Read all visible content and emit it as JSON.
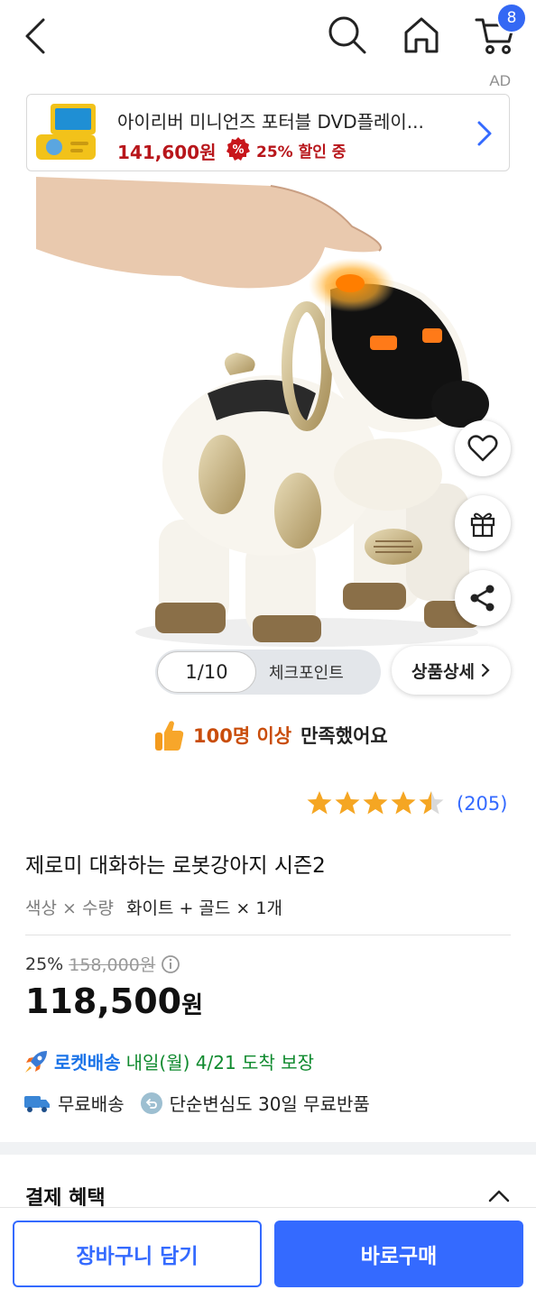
{
  "header": {
    "cart_count": "8",
    "ad_label": "AD"
  },
  "ad": {
    "title": "아이리버 미니언즈 포터블 DVD플레이...",
    "price": "141,600원",
    "discount_icon_symbol": "%",
    "discount": "25% 할인 중"
  },
  "gallery": {
    "counter": "1/10",
    "checkpoint": "체크포인트",
    "detail_label": "상품상세"
  },
  "satisfaction": {
    "highlight": "100명 이상",
    "rest": "만족했어요"
  },
  "rating": {
    "stars": 4.5,
    "count": "(205)"
  },
  "product": {
    "title": "제로미 대화하는 로봇강아지 시즌2",
    "option_label": "색상 × 수량",
    "option_value": "화이트 + 골드 × 1개",
    "discount_rate": "25%",
    "original_price": "158,000원",
    "price_number": "118,500",
    "price_unit": "원"
  },
  "delivery": {
    "rocket_label": "로켓배송",
    "arrival": "내일(월) 4/21 도착 보장",
    "free_shipping": "무료배송",
    "return_policy": "단순변심도 30일 무료반품"
  },
  "benefits": {
    "title": "결제 혜택"
  },
  "actions": {
    "add_to_cart": "장바구니 담기",
    "buy_now": "바로구매"
  },
  "colors": {
    "accent": "#346aff",
    "ad_red": "#b8161b",
    "rocket_green": "#0f8a2e",
    "star": "#f5a623"
  }
}
